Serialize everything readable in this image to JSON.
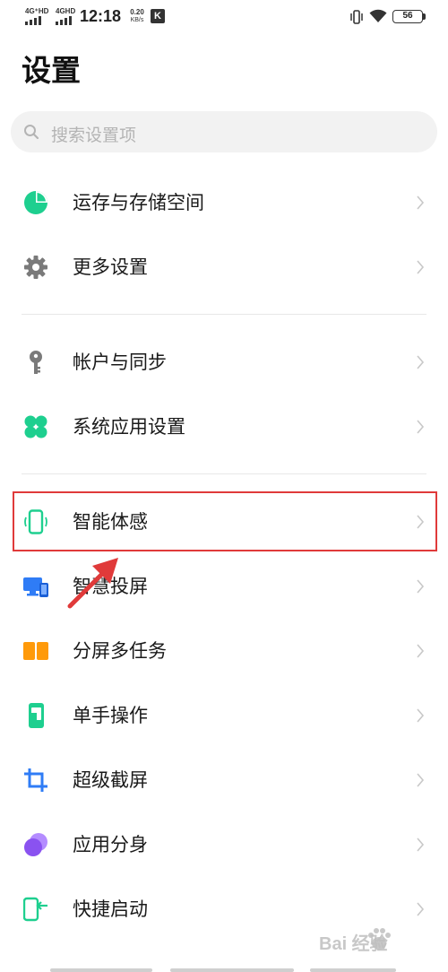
{
  "status_bar": {
    "signal1_label": "4G⁺HD",
    "signal2_label": "4GHD",
    "time": "12:18",
    "net_speed": "0.20",
    "net_speed_unit": "KB/s",
    "k_app": "K",
    "battery": "56"
  },
  "header": {
    "title": "设置"
  },
  "search": {
    "placeholder": "搜索设置项"
  },
  "items": [
    {
      "label": "运存与存储空间",
      "icon": "pie-chart-icon",
      "color": "#1ecf8f"
    },
    {
      "label": "更多设置",
      "icon": "gear-icon",
      "color": "#7a7a7a"
    },
    {
      "label": "帐户与同步",
      "icon": "key-icon",
      "color": "#7a7a7a"
    },
    {
      "label": "系统应用设置",
      "icon": "four-petal-icon",
      "color": "#1ecf8f"
    },
    {
      "label": "智能体感",
      "icon": "phone-motion-icon",
      "color": "#1ecf8f"
    },
    {
      "label": "智慧投屏",
      "icon": "screen-cast-icon",
      "color": "#2f7cf6"
    },
    {
      "label": "分屏多任务",
      "icon": "split-screen-icon",
      "color": "#ff9a0a"
    },
    {
      "label": "单手操作",
      "icon": "one-hand-icon",
      "color": "#1ecf8f"
    },
    {
      "label": "超级截屏",
      "icon": "crop-icon",
      "color": "#2f7cf6"
    },
    {
      "label": "应用分身",
      "icon": "app-clone-icon",
      "color": "#8a52f0"
    },
    {
      "label": "快捷启动",
      "icon": "quick-launch-icon",
      "color": "#1ecf8f"
    }
  ],
  "annotation": {
    "highlight_color": "#e03a3a"
  },
  "watermark": {
    "text": "Bai 经验"
  }
}
